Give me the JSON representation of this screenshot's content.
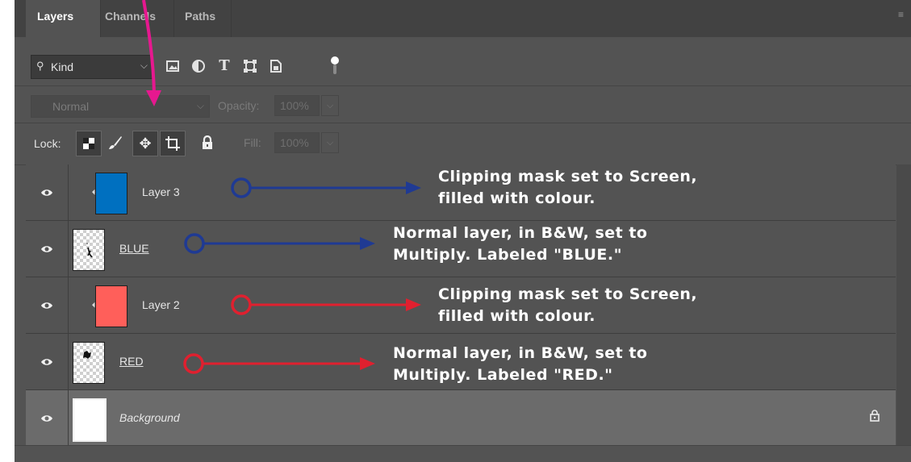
{
  "tabs": [
    {
      "label": "Layers",
      "active": true
    },
    {
      "label": "Channels",
      "active": false
    },
    {
      "label": "Paths",
      "active": false
    }
  ],
  "filter": {
    "kind_label": "Kind",
    "icons": [
      "image-filter-icon",
      "adjustment-filter-icon",
      "type-filter-icon",
      "shape-filter-icon",
      "smart-object-filter-icon",
      "filter-toggle-icon"
    ]
  },
  "blend": {
    "mode": "Normal",
    "opacity_label": "Opacity:",
    "opacity_value": "100%"
  },
  "lock": {
    "label": "Lock:",
    "fill_label": "Fill:",
    "fill_value": "100%",
    "icons": [
      "lock-transparent-pixels-icon",
      "lock-image-pixels-icon",
      "lock-position-icon",
      "lock-artboard-icon",
      "lock-all-icon"
    ]
  },
  "layers": [
    {
      "name": "Layer 3",
      "clipped": true,
      "thumb_color": "#0070c0"
    },
    {
      "name": "BLUE",
      "clipped": false,
      "thumb": "transparent-with-drawing"
    },
    {
      "name": "Layer 2",
      "clipped": true,
      "thumb_color": "#ff5f5a"
    },
    {
      "name": "RED",
      "clipped": false,
      "thumb": "transparent-with-drawing"
    },
    {
      "name": "Background",
      "clipped": false,
      "thumb_color": "#ffffff",
      "locked": true
    }
  ],
  "annotations": [
    {
      "line1": "Clipping mask set to Screen,",
      "line2": "filled with colour.",
      "color": "#1f3a93"
    },
    {
      "line1": "Normal layer, in B&W, set to",
      "line2": "Multiply. Labeled \"BLUE.\"",
      "color": "#1f3a93"
    },
    {
      "line1": "Clipping mask set to Screen,",
      "line2": "filled with colour.",
      "color": "#e0202f"
    },
    {
      "line1": "Normal layer, in B&W, set to",
      "line2": "Multiply. Labeled \"RED.\"",
      "color": "#e0202f"
    }
  ],
  "colors": {
    "panel": "#535353",
    "pointer_arrow": "#e6188f",
    "blue_arrow": "#1f3a93",
    "red_arrow": "#e0202f"
  }
}
